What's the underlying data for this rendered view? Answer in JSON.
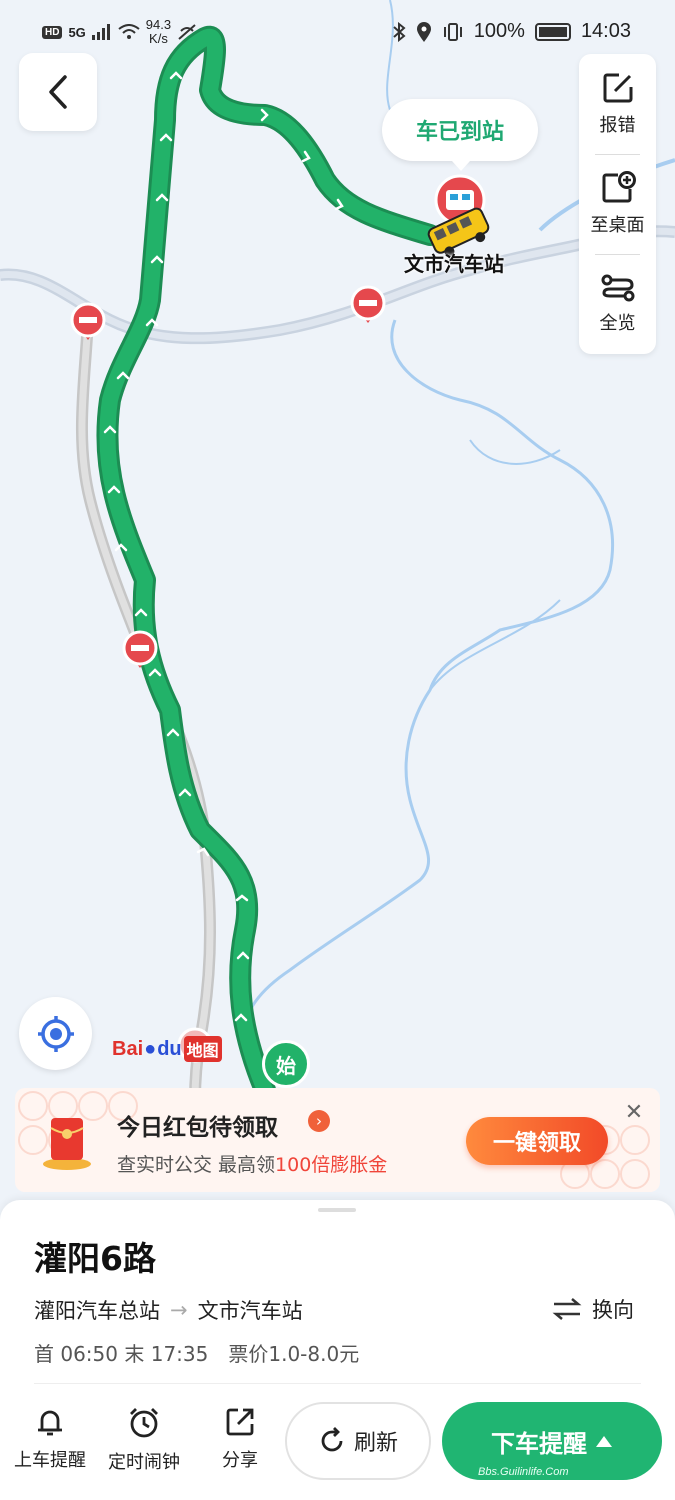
{
  "status_bar": {
    "hd": "HD",
    "network": "5G",
    "speed_value": "94.3",
    "speed_unit": "K/s",
    "battery": "100%",
    "time": "14:03"
  },
  "toolbar": {
    "report_label": "报错",
    "desktop_label": "至桌面",
    "overview_label": "全览"
  },
  "map": {
    "arrived_bubble": "车已到站",
    "station_label": "文市汽车站",
    "start_marker": "始",
    "logo_bai": "Bai",
    "logo_du": "du",
    "logo_ditu": "地图"
  },
  "promo": {
    "title": "今日红包待领取",
    "sub_prefix": "查实时公交 最高领",
    "sub_highlight": "100倍膨胀金",
    "button": "一键领取"
  },
  "route": {
    "name": "灌阳6路",
    "from": "灌阳汽车总站",
    "to": "文市汽车站",
    "swap_label": "换向",
    "first_label": "首",
    "first_time": "06:50",
    "last_label": "末",
    "last_time": "17:35",
    "fare": "票价1.0-8.0元"
  },
  "actions": {
    "boarding_alert": "上车提醒",
    "timer_alarm": "定时闹钟",
    "share": "分享",
    "refresh": "刷新",
    "alight_alert": "下车提醒",
    "watermark": "Bbs.Guilinlife.Com"
  },
  "colors": {
    "route_green": "#22b269",
    "river_blue": "#a8cdf0",
    "road_gray": "#c9d3e0",
    "accent_red": "#f0453a"
  }
}
